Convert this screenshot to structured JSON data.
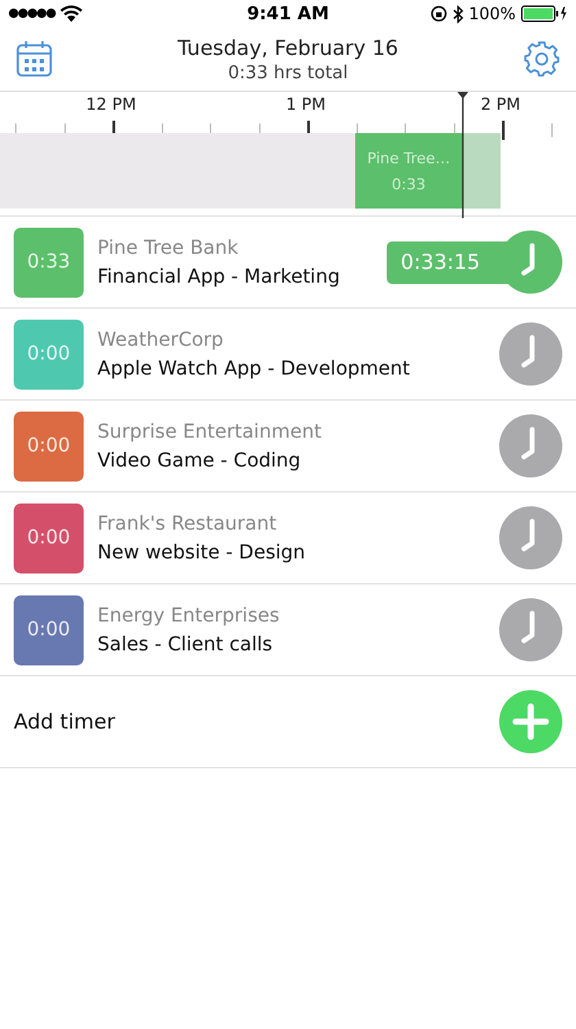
{
  "status_bar": {
    "signal": "●●●●●",
    "time": "9:41 AM",
    "battery": "100%"
  },
  "header": {
    "title": "Tuesday, February 16",
    "subtitle": "0:33 hrs total"
  },
  "timeline": {
    "hours": [
      "12 PM",
      "1 PM",
      "2 PM"
    ],
    "entry": {
      "title": "Pine Tree…",
      "duration": "0:33",
      "color": "#5cbf6b"
    }
  },
  "timers": [
    {
      "total": "0:33",
      "client": "Pine Tree Bank",
      "project": "Financial App - Marketing",
      "color": "#5cbf6b",
      "running": true,
      "elapsed": "0:33:15"
    },
    {
      "total": "0:00",
      "client": "WeatherCorp",
      "project": "Apple Watch App - Development",
      "color": "#4ec9b0",
      "running": false
    },
    {
      "total": "0:00",
      "client": "Surprise Entertainment",
      "project": "Video Game - Coding",
      "color": "#dc6a42",
      "running": false
    },
    {
      "total": "0:00",
      "client": "Frank's Restaurant",
      "project": "New website - Design",
      "color": "#d4506a",
      "running": false
    },
    {
      "total": "0:00",
      "client": "Energy Enterprises",
      "project": "Sales - Client calls",
      "color": "#6878b0",
      "running": false
    }
  ],
  "add_timer": {
    "label": "Add timer"
  }
}
